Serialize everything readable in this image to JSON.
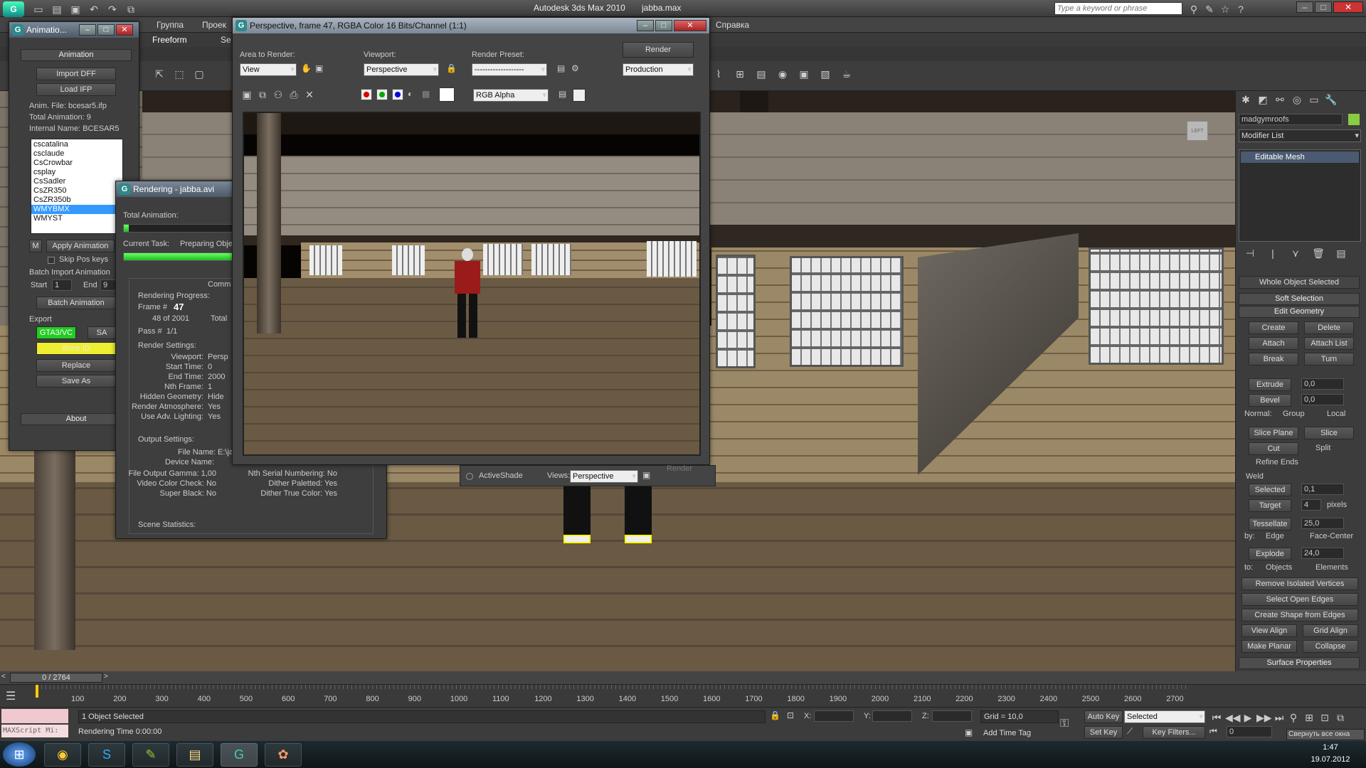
{
  "app": {
    "title": "Autodesk 3ds Max  2010",
    "file": "jabba.max",
    "search_placeholder": "Type a keyword or phrase"
  },
  "menu": [
    "Группа",
    "Проек",
    "Справка"
  ],
  "ribbon_tabs": [
    "Freeform",
    "Se"
  ],
  "anim_window": {
    "title": "Animatio...",
    "section": "Animation",
    "import_dff": "Import DFF",
    "load_ifp": "Load IFP",
    "anim_file": "Anim. File: bcesar5.ifp",
    "total_anim": "Total Animation: 9",
    "internal_name": "Internal Name: BCESAR5",
    "list": [
      "cscatalina",
      "csclaude",
      "CsCrowbar",
      "csplay",
      "CsSadler",
      "CsZR350",
      "CsZR350b",
      "WMYBMX",
      "WMYST"
    ],
    "selected_index": 7,
    "m_label": "M",
    "apply_animation": "Apply Animation",
    "skip_pos_keys": "Skip Pos keys",
    "batch_import": "Batch Import Animation",
    "start_label": "Start",
    "start_value": "1",
    "end_label": "End",
    "end_value": "9",
    "batch_animation": "Batch Animation",
    "export_label": "Export",
    "gta3vc": "GTA3/VC",
    "sa": "SA",
    "bone_id": "Bone ID",
    "replace": "Replace",
    "save_as": "Save As",
    "about": "About"
  },
  "rendering_window": {
    "title": "Rendering - jabba.avi",
    "total_animation": "Total Animation:",
    "total_progress": 0.02,
    "current_task": "Current Task:",
    "current_task_value": "Preparing Obje",
    "task_progress": 1.0,
    "common": "Comm",
    "rendering_progress": "Rendering Progress:",
    "frame_label": "Frame #",
    "frame_value": "47",
    "of_label": "48 of 2001",
    "total_label": "Total",
    "pass_label": "Pass #",
    "pass_value": "1/1",
    "render_settings": "Render Settings:",
    "settings": [
      [
        "Viewport:",
        "Persp"
      ],
      [
        "Start Time:",
        "0"
      ],
      [
        "End Time:",
        "2000"
      ],
      [
        "Nth Frame:",
        "1"
      ],
      [
        "Hidden Geometry:",
        "Hide"
      ],
      [
        "Render Atmosphere:",
        "Yes"
      ],
      [
        "Use Adv. Lighting:",
        "Yes"
      ]
    ],
    "output_settings": "Output Settings:",
    "file_name_label": "File Name:",
    "file_name_value": "E:\\jab",
    "device_name_label": "Device Name:",
    "output_rows": [
      [
        "File Output Gamma: 1,00",
        "Nth Serial Numbering: No"
      ],
      [
        "Video Color Check: No",
        "Dither Paletted: Yes"
      ],
      [
        "Super Black: No",
        "Dither True Color: Yes"
      ]
    ],
    "scene_statistics": "Scene Statistics:"
  },
  "frame_window": {
    "title": "Perspective, frame 47, RGBA Color 16 Bits/Channel (1:1)",
    "area_label": "Area to Render:",
    "area_value": "View",
    "viewport_label": "Viewport:",
    "viewport_value": "Perspective",
    "preset_label": "Render Preset:",
    "preset_value": "-------------------",
    "render_button": "Render",
    "production_value": "Production",
    "channel_value": "RGB Alpha",
    "activeshade": "ActiveShade",
    "views_label": "Views:",
    "views_value": "Perspective",
    "render_small": "Render"
  },
  "viewport_label": "LEFT",
  "command_panel": {
    "object_name": "madgymroofs",
    "modifier_list": "Modifier List",
    "stack_item": "Editable Mesh",
    "whole_object": "Whole Object Selected",
    "soft_selection": "Soft Selection",
    "edit_geometry": "Edit Geometry",
    "create": "Create",
    "delete": "Delete",
    "attach": "Attach",
    "attach_list": "Attach List",
    "break": "Break",
    "turn": "Turn",
    "extrude": "Extrude",
    "extrude_val": "0,0",
    "bevel": "Bevel",
    "bevel_val": "0,0",
    "normal": "Normal:",
    "group": "Group",
    "local": "Local",
    "slice_plane": "Slice Plane",
    "slice": "Slice",
    "cut": "Cut",
    "split": "Split",
    "refine_ends": "Refine Ends",
    "weld": "Weld",
    "selected": "Selected",
    "selected_val": "0,1",
    "target": "Target",
    "target_val": "4",
    "pixels": "pixels",
    "tessellate": "Tessellate",
    "tess_val": "25,0",
    "by": "by:",
    "edge": "Edge",
    "face_center": "Face-Center",
    "explode": "Explode",
    "explode_val": "24,0",
    "to": "to:",
    "objects": "Objects",
    "elements": "Elements",
    "remove_isolated": "Remove Isolated Vertices",
    "select_open": "Select Open Edges",
    "create_shape": "Create Shape from Edges",
    "view_align": "View Align",
    "grid_align": "Grid Align",
    "make_planar": "Make Planar",
    "collapse": "Collapse",
    "surface_properties": "Surface Properties"
  },
  "timeline": {
    "slider": "0 / 2764",
    "ticks": [
      "100",
      "200",
      "300",
      "400",
      "500",
      "600",
      "700",
      "800",
      "900",
      "1000",
      "1100",
      "1200",
      "1300",
      "1400",
      "1500",
      "1600",
      "1700",
      "1800",
      "1900",
      "2000",
      "2100",
      "2200",
      "2300",
      "2400",
      "2500",
      "2600",
      "2700"
    ]
  },
  "status": {
    "maxscript": "MAXScript Mi:",
    "selection": "1 Object Selected",
    "render_time": "Rendering Time  0:00:00",
    "x_label": "X:",
    "y_label": "Y:",
    "z_label": "Z:",
    "grid": "Grid = 10,0",
    "add_time_tag": "Add Time Tag",
    "auto_key": "Auto Key",
    "set_key": "Set Key",
    "selected_dd": "Selected",
    "key_filters": "Key Filters...",
    "frame_field": "0",
    "collapse_all": "Свернуть все окна"
  },
  "tray": {
    "time": "1:47",
    "date": "19.07.2012"
  }
}
